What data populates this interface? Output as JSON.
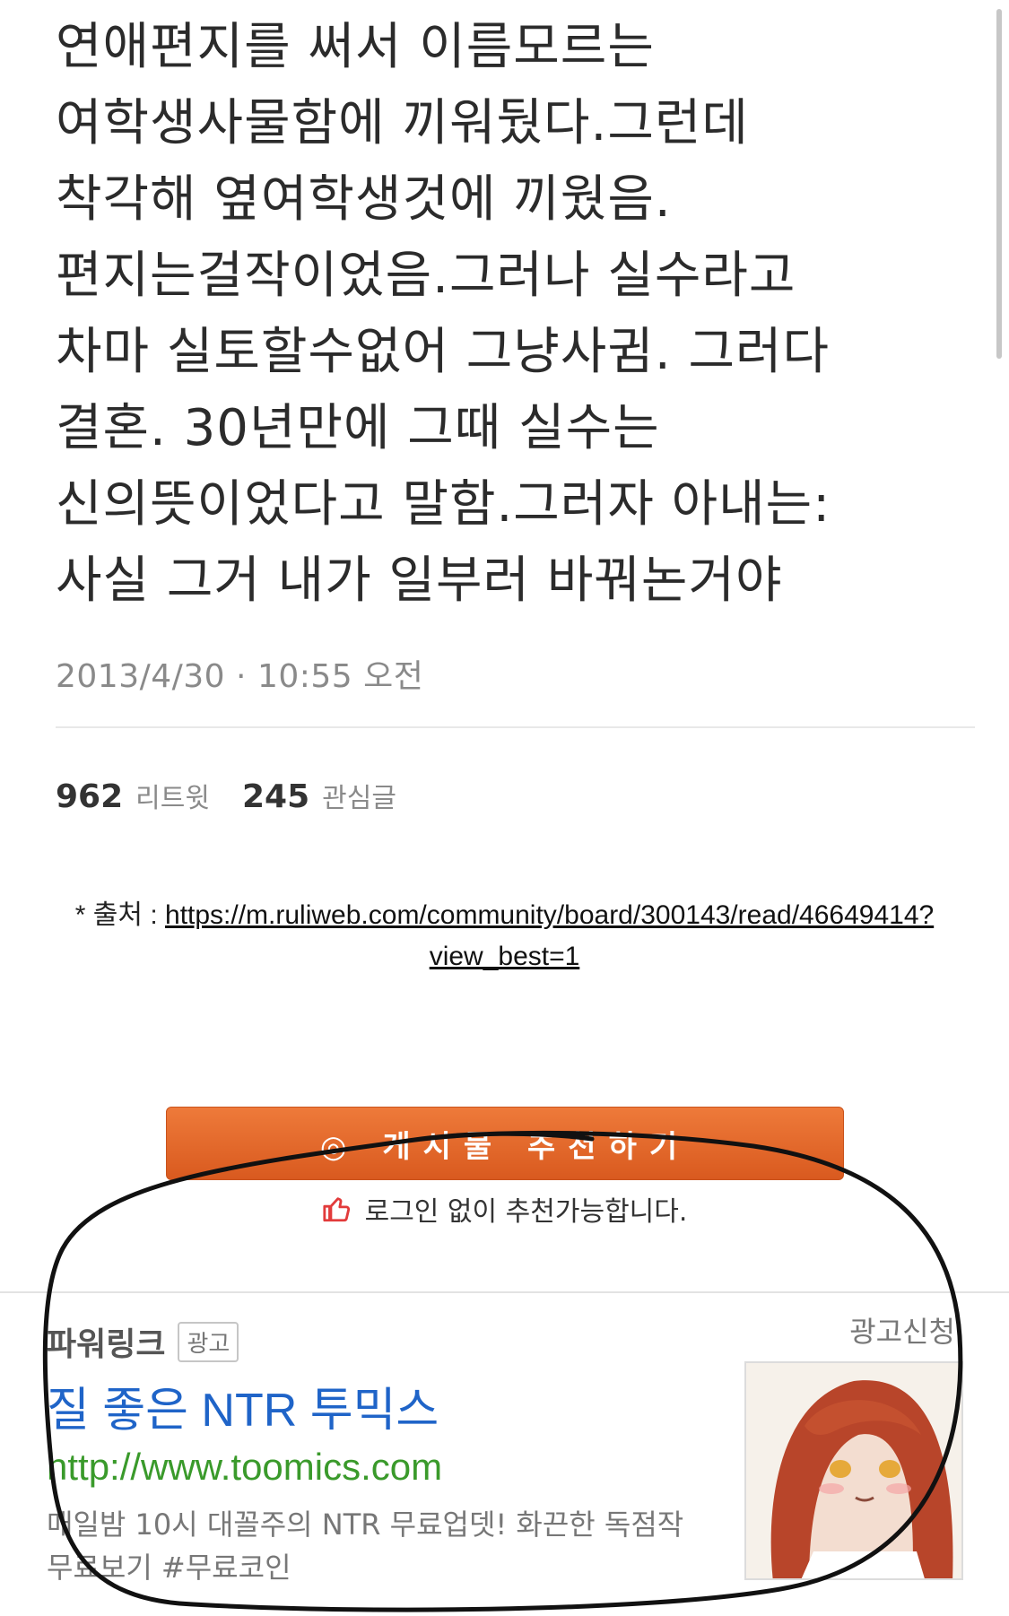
{
  "tweet": {
    "lines": [
      "연애편지를 써서 이름모르는",
      "여학생사물함에 끼워뒀다.그런데",
      "착각해 옆여학생것에 끼웠음.",
      "편지는걸작이었음.그러나 실수라고",
      "차마 실토할수없어 그냥사귐. 그러다",
      "결혼. 30년만에 그때 실수는",
      "신의뜻이었다고 말함.그러자 아내는:",
      "사실 그거 내가 일부러 바꿔논거야"
    ],
    "date": "2013/4/30",
    "time": "10:55 오전",
    "retweets_count": "962",
    "retweets_label": "리트윗",
    "likes_count": "245",
    "likes_label": "관심글"
  },
  "source": {
    "prefix": "* 출처 : ",
    "url_line1": "https://m.ruliweb.com/community/board/300143/read/46649414?",
    "url_line2": "view_best=1"
  },
  "recommend": {
    "button_label": "◎ 게시물 추천하기",
    "note": "로그인 없이 추천가능합니다."
  },
  "ad": {
    "brand": "파워링크",
    "badge": "광고",
    "apply_label": "광고신청",
    "title": "질 좋은 NTR 투믹스",
    "url": "http://www.toomics.com",
    "desc_line1": "매일밤 10시 대꼴주의 NTR 무료업뎃! 화끈한 독점작",
    "desc_line2": "무료보기 #무료코인"
  },
  "colors": {
    "accent_orange": "#e06a2a",
    "link_blue": "#1f64c8",
    "url_green": "#3a9a2b",
    "thumb_red": "#e23b3b"
  }
}
